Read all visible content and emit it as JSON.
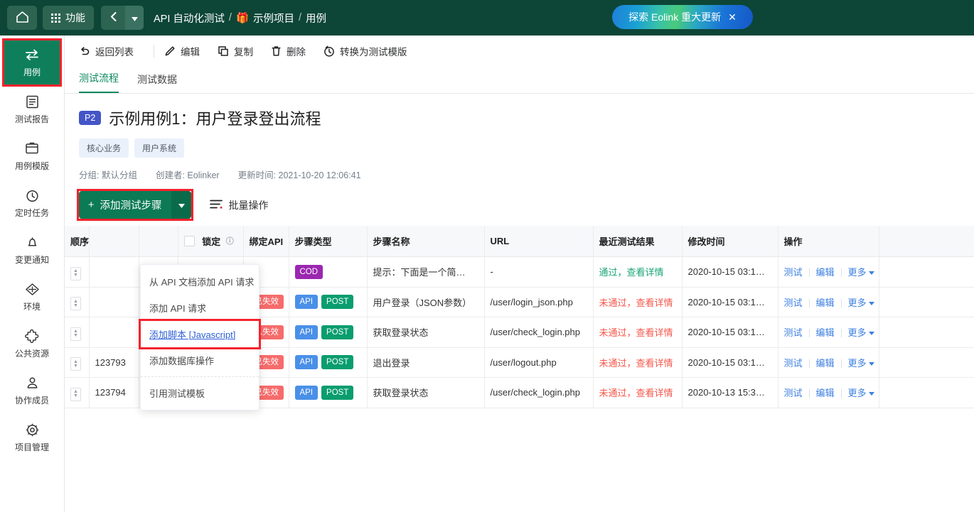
{
  "topbar": {
    "home_icon": "home-icon",
    "apps_label": "功能",
    "apps_icon": "grid-icon",
    "back_icon": "chevron-left-icon",
    "dropdown_icon": "caret-down-icon",
    "breadcrumb": [
      "API 自动化测试",
      "示例项目",
      "用例"
    ],
    "breadcrumb_separator": "/",
    "project_icon": "gift-icon",
    "promo_text": "探索 Eolink 重大更新",
    "promo_close": "✕",
    "bg_color": "#0d4637"
  },
  "sidebar": {
    "items": [
      {
        "label": "用例",
        "icon": "exchange-icon",
        "active": true,
        "highlighted": true
      },
      {
        "label": "测试报告",
        "icon": "report-icon",
        "active": false,
        "highlighted": false
      },
      {
        "label": "用例模版",
        "icon": "template-icon",
        "active": false,
        "highlighted": false
      },
      {
        "label": "定时任务",
        "icon": "clock-icon",
        "active": false,
        "highlighted": false
      },
      {
        "label": "变更通知",
        "icon": "bell-icon",
        "active": false,
        "highlighted": false
      },
      {
        "label": "环境",
        "icon": "cube-icon",
        "active": false,
        "highlighted": false
      },
      {
        "label": "公共资源",
        "icon": "puzzle-icon",
        "active": false,
        "highlighted": false
      },
      {
        "label": "协作成员",
        "icon": "user-icon",
        "active": false,
        "highlighted": false
      },
      {
        "label": "项目管理",
        "icon": "gear-icon",
        "active": false,
        "highlighted": false
      }
    ],
    "active_color": "#0f7f5b"
  },
  "toolbar": {
    "back_label": "返回列表",
    "back_icon": "undo-icon",
    "edit_label": "编辑",
    "edit_icon": "pencil-icon",
    "copy_label": "复制",
    "copy_icon": "copy-icon",
    "delete_label": "删除",
    "delete_icon": "trash-icon",
    "convert_label": "转换为测试模版",
    "convert_icon": "history-icon"
  },
  "tabs": [
    {
      "label": "测试流程",
      "active": true
    },
    {
      "label": "测试数据",
      "active": false
    }
  ],
  "detail": {
    "priority": "P2",
    "title": "示例用例1：用户登录登出流程",
    "tags": [
      "核心业务",
      "用户系统"
    ],
    "group_label": "分组: 默认分组",
    "creator_label": "创建者: Eolinker",
    "updated_label": "更新时间: 2021-10-20 12:06:41"
  },
  "actions": {
    "add_step_label": "添加测试步骤",
    "add_step_plus": "+",
    "add_step_caret": "caret-down-icon",
    "batch_label": "批量操作",
    "batch_icon": "list-icon",
    "add_step_highlighted": true
  },
  "dropdown": {
    "open": true,
    "items": [
      {
        "label": "从 API 文档添加 API 请求",
        "selected": false,
        "separator_after": false
      },
      {
        "label": "添加 API 请求",
        "selected": false,
        "separator_after": false
      },
      {
        "label": "添加脚本 [Javascript]",
        "selected": true,
        "separator_after": false
      },
      {
        "label": "添加数据库操作",
        "selected": false,
        "separator_after": true
      },
      {
        "label": "引用测试模板",
        "selected": false,
        "separator_after": false
      }
    ]
  },
  "table": {
    "headers": [
      {
        "label": "顺序",
        "name": "order"
      },
      {
        "label": "",
        "name": "id"
      },
      {
        "label": "",
        "name": "enabled"
      },
      {
        "label": "锁定",
        "name": "lock",
        "info_icon": true,
        "checkbox": true
      },
      {
        "label": "绑定API",
        "name": "bind-api"
      },
      {
        "label": "步骤类型",
        "name": "step-type"
      },
      {
        "label": "步骤名称",
        "name": "step-name"
      },
      {
        "label": "URL",
        "name": "url"
      },
      {
        "label": "最近测试结果",
        "name": "last-result"
      },
      {
        "label": "修改时间",
        "name": "modified-time"
      },
      {
        "label": "操作",
        "name": "operations"
      },
      {
        "label": "",
        "name": "trailing"
      }
    ],
    "rows": [
      {
        "id": "",
        "enabled": true,
        "locked": false,
        "bind_api": "",
        "types": [
          {
            "text": "COD",
            "style": "b-cod"
          }
        ],
        "step_name": "提示：下面是一个简…",
        "url": "-",
        "result_text": "通过，查看详情",
        "result_status": "pass",
        "modified": "2020-10-15 03:1…",
        "ops": [
          "测试",
          "编辑",
          "更多"
        ]
      },
      {
        "id": "",
        "enabled": true,
        "locked": false,
        "bind_api": "已失效",
        "types": [
          {
            "text": "API",
            "style": "b-api"
          },
          {
            "text": "POST",
            "style": "b-post"
          }
        ],
        "step_name": "用户登录（JSON参数）",
        "url": "/user/login_json.php",
        "result_text": "未通过，查看详情",
        "result_status": "fail",
        "modified": "2020-10-15 03:1…",
        "ops": [
          "测试",
          "编辑",
          "更多"
        ]
      },
      {
        "id": "",
        "enabled": true,
        "locked": false,
        "bind_api": "已失效",
        "types": [
          {
            "text": "API",
            "style": "b-api"
          },
          {
            "text": "POST",
            "style": "b-post"
          }
        ],
        "step_name": "获取登录状态",
        "url": "/user/check_login.php",
        "result_text": "未通过，查看详情",
        "result_status": "fail",
        "modified": "2020-10-15 03:1…",
        "ops": [
          "测试",
          "编辑",
          "更多"
        ]
      },
      {
        "id": "123793",
        "enabled": true,
        "locked": false,
        "bind_api": "已失效",
        "types": [
          {
            "text": "API",
            "style": "b-api"
          },
          {
            "text": "POST",
            "style": "b-post"
          }
        ],
        "step_name": "退出登录",
        "url": "/user/logout.php",
        "result_text": "未通过，查看详情",
        "result_status": "fail",
        "modified": "2020-10-15 03:1…",
        "ops": [
          "测试",
          "编辑",
          "更多"
        ]
      },
      {
        "id": "123794",
        "enabled": true,
        "locked": false,
        "bind_api": "已失效",
        "types": [
          {
            "text": "API",
            "style": "b-api"
          },
          {
            "text": "POST",
            "style": "b-post"
          }
        ],
        "step_name": "获取登录状态",
        "url": "/user/check_login.php",
        "result_text": "未通过，查看详情",
        "result_status": "fail",
        "modified": "2020-10-13 15:3…",
        "ops": [
          "测试",
          "编辑",
          "更多"
        ]
      }
    ],
    "op_more_caret": "caret-down-icon"
  },
  "colors": {
    "brand_dark": "#0d4637",
    "brand_green": "#0b7a55",
    "accent_link": "#3a7ee0",
    "pass": "#17a673",
    "fail": "#f5564a",
    "highlight_box": "#f5222d",
    "badge_cod": "#9b27b0",
    "badge_api": "#4a90e8",
    "badge_post": "#0a9d6e",
    "badge_invalid": "#f76b6b",
    "priority": "#4455c7"
  }
}
